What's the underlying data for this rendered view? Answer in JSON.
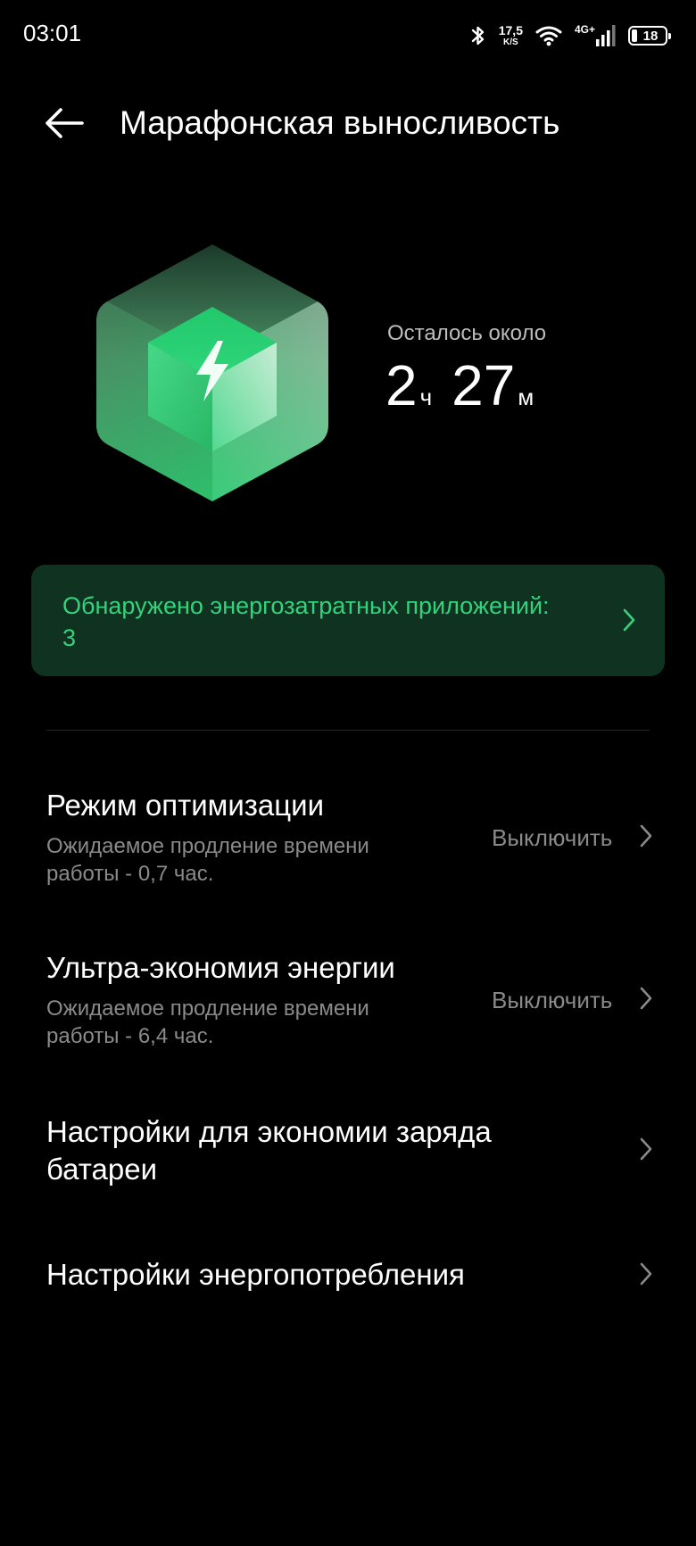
{
  "status_bar": {
    "time": "03:01",
    "net_speed_value": "17,5",
    "net_speed_unit": "K/S",
    "network_type": "4G+",
    "battery_level": "18",
    "battery_fraction": 0.18
  },
  "header": {
    "title": "Марафонская выносливость"
  },
  "hero": {
    "remaining_label": "Осталось около",
    "hours": "2",
    "hours_unit": "ч",
    "minutes": "27",
    "minutes_unit": "м"
  },
  "alert": {
    "text": "Обнаружено энергозатратных приложений: 3"
  },
  "settings": [
    {
      "title": "Режим оптимизации",
      "subtitle": "Ожидаемое продление времени работы - 0,7 час.",
      "value": "Выключить"
    },
    {
      "title": "Ультра-экономия энергии",
      "subtitle": "Ожидаемое продление времени работы - 6,4 час.",
      "value": "Выключить"
    },
    {
      "title": "Настройки для экономии заряда батареи"
    },
    {
      "title": "Настройки энергопотребления"
    }
  ],
  "colors": {
    "background": "#000000",
    "accent_green": "#35d27d",
    "alert_background": "#0f3320",
    "secondary_text": "#8a8a8a"
  },
  "icons": [
    "bluetooth-icon",
    "wifi-icon",
    "signal-icon",
    "battery-icon",
    "back-arrow-icon",
    "battery-cube-icon",
    "chevron-right-icon"
  ]
}
